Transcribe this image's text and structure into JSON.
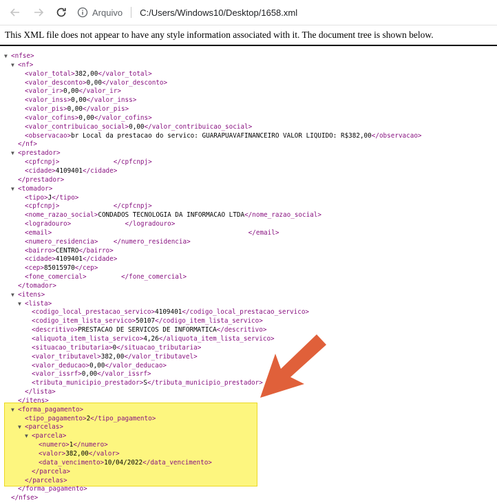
{
  "browser": {
    "address_label": "Arquivo",
    "url": "C:/Users/Windows10/Desktop/1658.xml"
  },
  "info_message": "This XML file does not appear to have any style information associated with it. The document tree is shown below.",
  "colors": {
    "tag": "#881280",
    "text": "#000000",
    "highlight": "#fdf569",
    "arrow": "#e0603a"
  },
  "icons": [
    "back-arrow-icon",
    "forward-arrow-icon",
    "reload-icon",
    "info-icon"
  ],
  "xml_lines": [
    {
      "indent": 0,
      "toggle": "▼",
      "open": "<nfse>",
      "value": "",
      "close": ""
    },
    {
      "indent": 1,
      "toggle": "▼",
      "open": "<nf>",
      "value": "",
      "close": ""
    },
    {
      "indent": 2,
      "toggle": "",
      "open": "<valor_total>",
      "value": "382,00",
      "close": "</valor_total>"
    },
    {
      "indent": 2,
      "toggle": "",
      "open": "<valor_desconto>",
      "value": "0,00",
      "close": "</valor_desconto>"
    },
    {
      "indent": 2,
      "toggle": "",
      "open": "<valor_ir>",
      "value": "0,00",
      "close": "</valor_ir>"
    },
    {
      "indent": 2,
      "toggle": "",
      "open": "<valor_inss>",
      "value": "0,00",
      "close": "</valor_inss>"
    },
    {
      "indent": 2,
      "toggle": "",
      "open": "<valor_pis>",
      "value": "0,00",
      "close": "</valor_pis>"
    },
    {
      "indent": 2,
      "toggle": "",
      "open": "<valor_cofins>",
      "value": "0,00",
      "close": "</valor_cofins>"
    },
    {
      "indent": 2,
      "toggle": "",
      "open": "<valor_contribuicao_social>",
      "value": "0,00",
      "close": "</valor_contribuicao_social>"
    },
    {
      "indent": 2,
      "toggle": "",
      "open": "<observacao>",
      "value": "br Local da prestacao do servico: GUARAPUAVAFINANCEIRO VALOR LIQUIDO: R$382,00",
      "close": "</observacao>"
    },
    {
      "indent": 1,
      "toggle": "",
      "open": "</nf>",
      "value": "",
      "close": ""
    },
    {
      "indent": 1,
      "toggle": "▼",
      "open": "<prestador>",
      "value": "",
      "close": ""
    },
    {
      "indent": 2,
      "toggle": "",
      "open": "<cpfcnpj>",
      "value": "              ",
      "close": "</cpfcnpj>"
    },
    {
      "indent": 2,
      "toggle": "",
      "open": "<cidade>",
      "value": "4109401",
      "close": "</cidade>"
    },
    {
      "indent": 1,
      "toggle": "",
      "open": "</prestador>",
      "value": "",
      "close": ""
    },
    {
      "indent": 1,
      "toggle": "▼",
      "open": "<tomador>",
      "value": "",
      "close": ""
    },
    {
      "indent": 2,
      "toggle": "",
      "open": "<tipo>",
      "value": "J",
      "close": "</tipo>"
    },
    {
      "indent": 2,
      "toggle": "",
      "open": "<cpfcnpj>",
      "value": "              ",
      "close": "</cpfcnpj>"
    },
    {
      "indent": 2,
      "toggle": "",
      "open": "<nome_razao_social>",
      "value": "CONDADOS TECNOLOGIA DA INFORMACAO LTDA",
      "close": "</nome_razao_social>"
    },
    {
      "indent": 2,
      "toggle": "",
      "open": "<logradouro>",
      "value": "              ",
      "close": "</logradouro>"
    },
    {
      "indent": 2,
      "toggle": "",
      "open": "<email>",
      "value": "                                                   ",
      "close": "</email>"
    },
    {
      "indent": 2,
      "toggle": "",
      "open": "<numero_residencia>",
      "value": "    ",
      "close": "</numero_residencia>"
    },
    {
      "indent": 2,
      "toggle": "",
      "open": "<bairro>",
      "value": "CENTRO",
      "close": "</bairro>"
    },
    {
      "indent": 2,
      "toggle": "",
      "open": "<cidade>",
      "value": "4109401",
      "close": "</cidade>"
    },
    {
      "indent": 2,
      "toggle": "",
      "open": "<cep>",
      "value": "85015970",
      "close": "</cep>"
    },
    {
      "indent": 2,
      "toggle": "",
      "open": "<fone_comercial>",
      "value": "         ",
      "close": "</fone_comercial>"
    },
    {
      "indent": 1,
      "toggle": "",
      "open": "</tomador>",
      "value": "",
      "close": ""
    },
    {
      "indent": 1,
      "toggle": "▼",
      "open": "<itens>",
      "value": "",
      "close": ""
    },
    {
      "indent": 2,
      "toggle": "▼",
      "open": "<lista>",
      "value": "",
      "close": ""
    },
    {
      "indent": 3,
      "toggle": "",
      "open": "<codigo_local_prestacao_servico>",
      "value": "4109401",
      "close": "</codigo_local_prestacao_servico>"
    },
    {
      "indent": 3,
      "toggle": "",
      "open": "<codigo_item_lista_servico>",
      "value": "50107",
      "close": "</codigo_item_lista_servico>"
    },
    {
      "indent": 3,
      "toggle": "",
      "open": "<descritivo>",
      "value": "PRESTACAO DE SERVICOS DE INFORMATICA",
      "close": "</descritivo>"
    },
    {
      "indent": 3,
      "toggle": "",
      "open": "<aliquota_item_lista_servico>",
      "value": "4,26",
      "close": "</aliquota_item_lista_servico>"
    },
    {
      "indent": 3,
      "toggle": "",
      "open": "<situacao_tributaria>",
      "value": "0",
      "close": "</situacao_tributaria>"
    },
    {
      "indent": 3,
      "toggle": "",
      "open": "<valor_tributavel>",
      "value": "382,00",
      "close": "</valor_tributavel>"
    },
    {
      "indent": 3,
      "toggle": "",
      "open": "<valor_deducao>",
      "value": "0,00",
      "close": "</valor_deducao>"
    },
    {
      "indent": 3,
      "toggle": "",
      "open": "<valor_issrf>",
      "value": "0,00",
      "close": "</valor_issrf>"
    },
    {
      "indent": 3,
      "toggle": "",
      "open": "<tributa_municipio_prestador>",
      "value": "S",
      "close": "</tributa_municipio_prestador>"
    },
    {
      "indent": 2,
      "toggle": "",
      "open": "</lista>",
      "value": "",
      "close": ""
    },
    {
      "indent": 1,
      "toggle": "",
      "open": "</itens>",
      "value": "",
      "close": ""
    },
    {
      "indent": 1,
      "toggle": "▼",
      "open": "<forma_pagamento>",
      "value": "",
      "close": ""
    },
    {
      "indent": 2,
      "toggle": "",
      "open": "<tipo_pagamento>",
      "value": "2",
      "close": "</tipo_pagamento>"
    },
    {
      "indent": 2,
      "toggle": "▼",
      "open": "<parcelas>",
      "value": "",
      "close": ""
    },
    {
      "indent": 3,
      "toggle": "▼",
      "open": "<parcela>",
      "value": "",
      "close": ""
    },
    {
      "indent": 4,
      "toggle": "",
      "open": "<numero>",
      "value": "1",
      "close": "</numero>"
    },
    {
      "indent": 4,
      "toggle": "",
      "open": "<valor>",
      "value": "382,00",
      "close": "</valor>"
    },
    {
      "indent": 4,
      "toggle": "",
      "open": "<data_vencimento>",
      "value": "10/04/2022",
      "close": "</data_vencimento>"
    },
    {
      "indent": 3,
      "toggle": "",
      "open": "</parcela>",
      "value": "",
      "close": ""
    },
    {
      "indent": 2,
      "toggle": "",
      "open": "</parcelas>",
      "value": "",
      "close": ""
    },
    {
      "indent": 1,
      "toggle": "",
      "open": "</forma_pagamento>",
      "value": "",
      "close": ""
    },
    {
      "indent": 0,
      "toggle": "",
      "open": "</nfse>",
      "value": "",
      "close": ""
    }
  ]
}
